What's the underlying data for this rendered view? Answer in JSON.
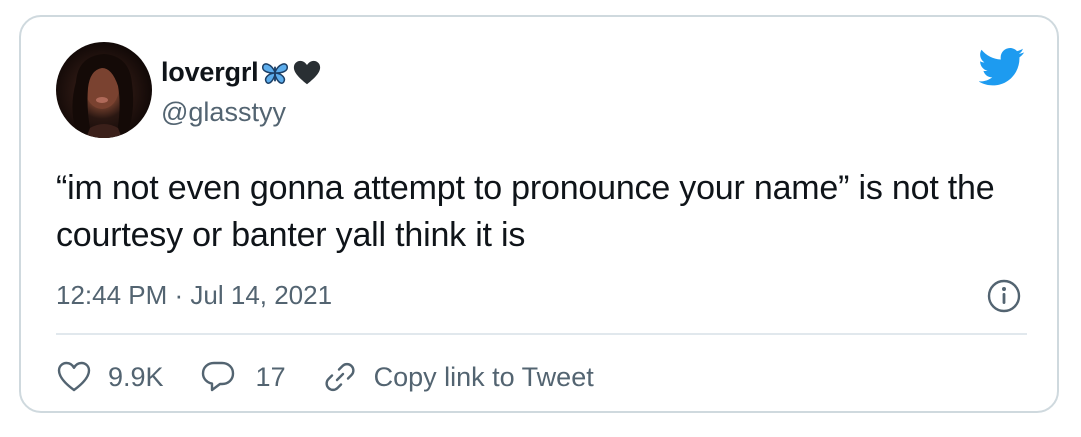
{
  "tweet": {
    "author": {
      "display_name": "lovergrl",
      "emojis": [
        "butterfly-icon",
        "black-heart-icon"
      ],
      "handle": "@glasstyy",
      "avatar": "avatar"
    },
    "brand_icon": "twitter-bird-icon",
    "text": "“im not even gonna attempt to pronounce your name” is not the courtesy or banter yall think it is",
    "timestamp": "12:44 PM · Jul 14, 2021",
    "info_icon": "info-icon",
    "actions": {
      "like_count": "9.9K",
      "reply_count": "17",
      "copy_link_label": "Copy link to Tweet"
    }
  },
  "colors": {
    "text_primary": "#0f1419",
    "text_secondary": "#536471",
    "twitter_blue": "#1d9bf0",
    "border": "#cfd9de",
    "divider": "#e1e8ed"
  }
}
